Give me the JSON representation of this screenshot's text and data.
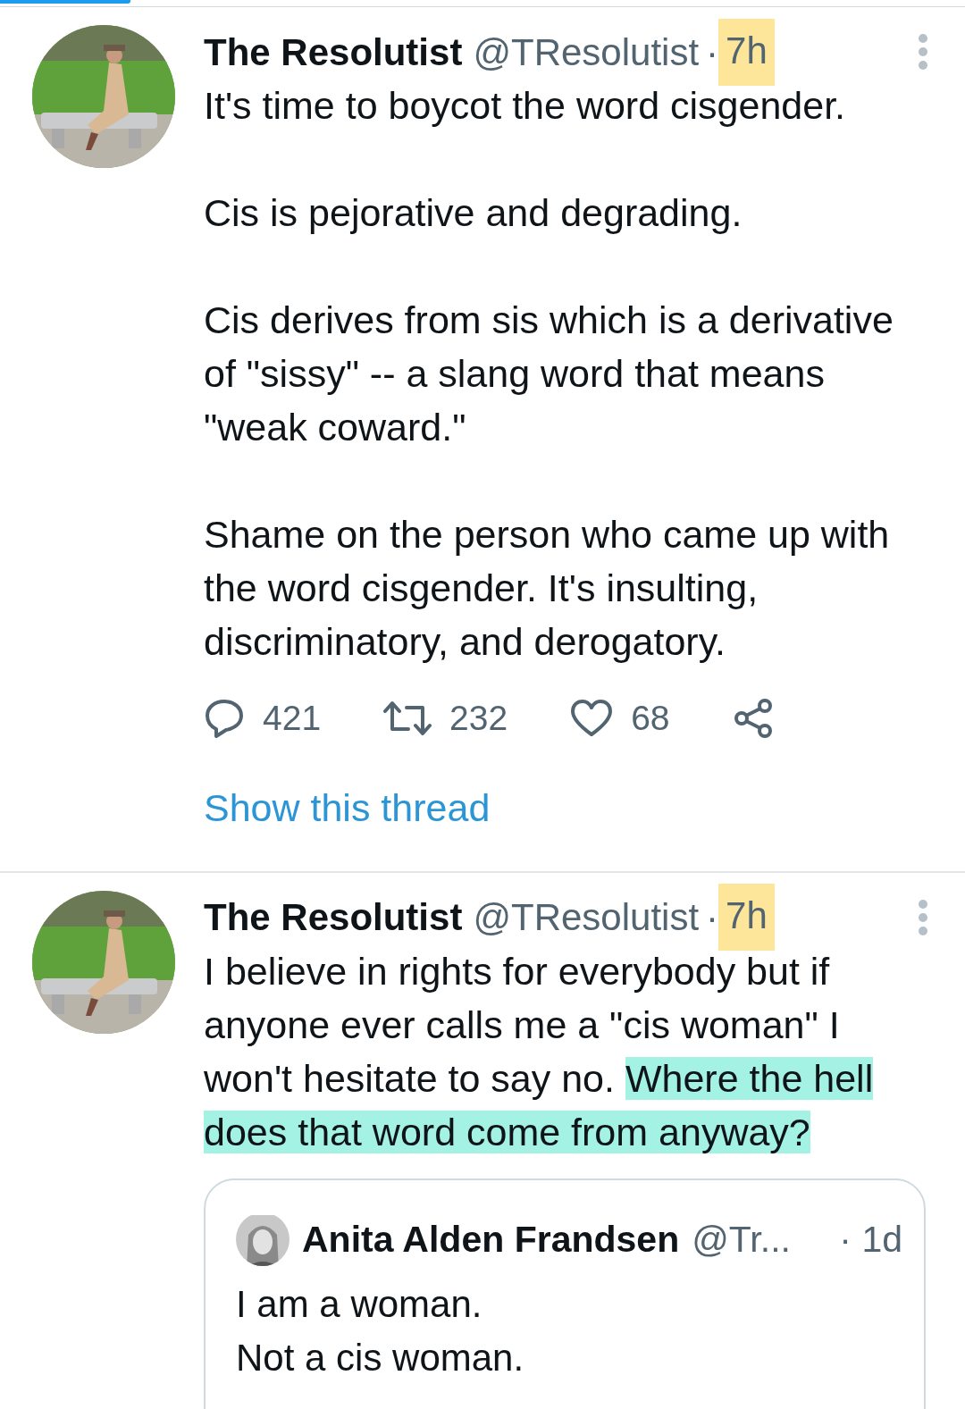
{
  "tweets": [
    {
      "name": "The Resolutist",
      "handle": "@TResolutist",
      "separator": "·",
      "time": "7h",
      "time_highlighted": true,
      "text": [
        {
          "text": "It's time to boycot the word cisgender.\n\nCis is pejorative and degrading.\n\nCis derives from sis which is a derivative\nof \"sissy\" -- a slang word that means\n\"weak coward.\"\n\nShame on the person who came up with\nthe word cisgender. It's insulting,\ndiscriminatory, and derogatory.",
          "highlighted": false
        }
      ],
      "actions": {
        "replies": "421",
        "retweets": "232",
        "likes": "68"
      },
      "thread_link": "Show this thread"
    },
    {
      "name": "The Resolutist",
      "handle": "@TResolutist",
      "separator": "·",
      "time": "7h",
      "time_highlighted": true,
      "text": [
        {
          "text": "I believe in rights for everybody but if\nanyone ever calls me a \"cis woman\" I\nwon't hesitate to say no. ",
          "highlighted": false
        },
        {
          "text": "Where the hell\ndoes that word come from anyway?",
          "highlighted": true
        }
      ],
      "quote": {
        "name": "Anita Alden Frandsen",
        "handle": "@Tr...",
        "time": "· 1d",
        "text": "I am a woman.\nNot a cis woman."
      }
    }
  ]
}
